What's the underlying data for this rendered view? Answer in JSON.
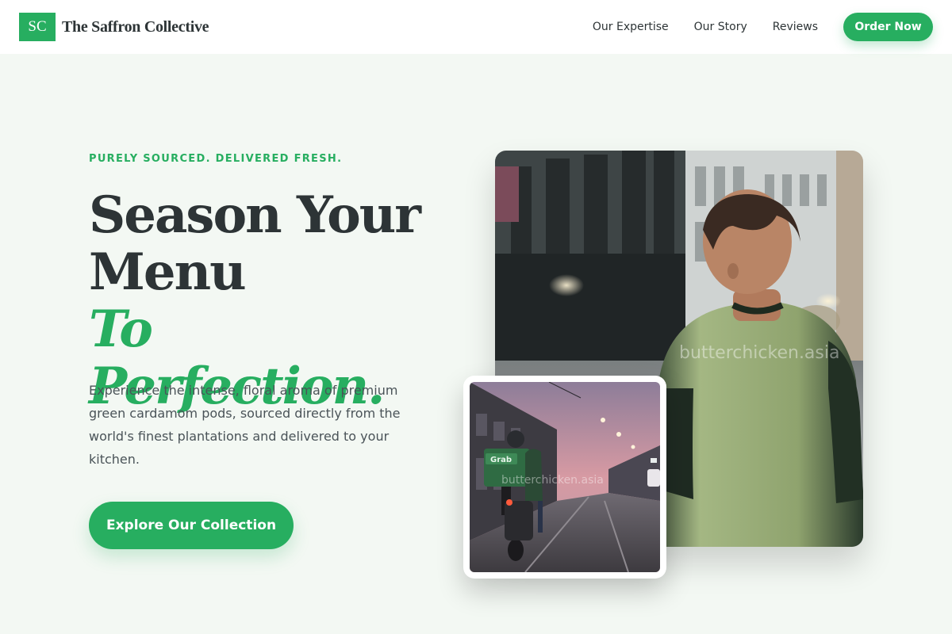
{
  "header": {
    "logo_initials": "SC",
    "brand_name": "The Saffron Collective",
    "nav": [
      "Our Expertise",
      "Our Story",
      "Reviews"
    ],
    "order_button": "Order Now"
  },
  "hero": {
    "eyebrow": "PURELY SOURCED. DELIVERED FRESH.",
    "headline_line1": "Season Your",
    "headline_line2": "Menu",
    "headline_accent": "To Perfection.",
    "description": "Experience the intense, floral aroma of premium green cardamom pods, sourced directly from the world's finest plantations and delivered to your kitchen.",
    "cta": "Explore Our Collection"
  },
  "images": {
    "watermark": "butterchicken.asia",
    "courier_box_text": "Grab"
  },
  "colors": {
    "accent": "#27ae60",
    "background": "#f3f8f3",
    "text": "#2d3436"
  }
}
